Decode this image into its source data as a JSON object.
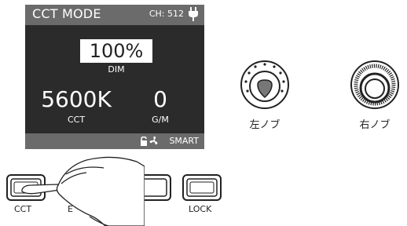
{
  "display": {
    "mode_title": "CCT MODE",
    "channel": "CH: 512",
    "dim_value": "100%",
    "dim_label": "DIM",
    "cct_value": "5600K",
    "cct_label": "CCT",
    "gm_value": "0",
    "gm_label": "G/M",
    "smart_label": "SMART"
  },
  "knobs": {
    "left_label": "左ノブ",
    "right_label": "右ノブ"
  },
  "buttons": {
    "cct_label": "CCT",
    "second_label_partial": "E",
    "lock_label": "LOCK"
  },
  "icons": [
    "plug-icon",
    "lock-icon",
    "fan-icon",
    "hand-icon",
    "knob-dotted-icon",
    "knob-ticked-icon"
  ],
  "colors": {
    "screen_bg": "#2b2b2b",
    "bar_bg": "#6b6b6b",
    "text_white": "#ffffff"
  }
}
